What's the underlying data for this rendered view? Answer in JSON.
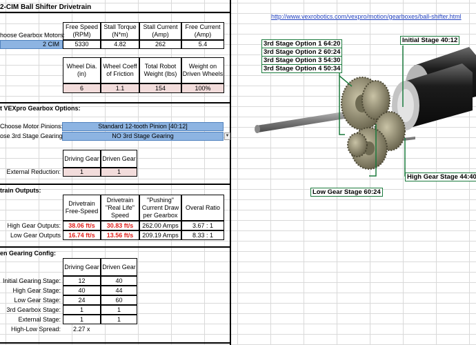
{
  "title": "2-CIM Ball Shifter Drivetrain",
  "link": "http://www.vexrobotics.com/vexpro/motion/gearboxes/ball-shifter.html",
  "motor_table": {
    "row_label": "hoose Gearbox Motors:",
    "motor_value": "2 CIM",
    "headers": [
      "Free Speed (RPM)",
      "Stall Torque (N*m)",
      "Stall Current (Amp)",
      "Free Current (Amp)"
    ],
    "values": [
      "5330",
      "4.82",
      "262",
      "5.4"
    ]
  },
  "wheel_table": {
    "headers": [
      "Wheel Dia. (in)",
      "Wheel Coeff of Friction",
      "Total Robot Weight (lbs)",
      "Weight on Driven Wheels"
    ],
    "values": [
      "6",
      "1.1",
      "154",
      "100%"
    ]
  },
  "options": {
    "section_label": "t VEXpro Gearbox Options:",
    "pinion_label": "Choose Motor Pinions:",
    "pinion_value": "Standard 12-tooth Pinion [40:12]",
    "stage3_label": "ose 3rd Stage Gearing:",
    "stage3_value": "NO 3rd Stage Gearing",
    "ext_headers": [
      "Driving Gear",
      "Driven Gear"
    ],
    "ext_label": "External Reduction:",
    "ext_values": [
      "1",
      "1"
    ]
  },
  "outputs": {
    "section_label": "train Outputs:",
    "headers": [
      "Drivetrain Free-Speed",
      "Drivetrain \"Real Life\" Speed",
      "\"Pushing\" Current Draw per Gearbox",
      "Overal Ratio"
    ],
    "rows": [
      {
        "label": "High Gear Outputs:",
        "free": "38.06 ft/s",
        "real": "30.83 ft/s",
        "current": "262.00 Amps",
        "ratio": "3.67 : 1"
      },
      {
        "label": "Low Gear Outputs",
        "free": "16.74 ft/s",
        "real": "13.56 ft/s",
        "current": "209.19 Amps",
        "ratio": "8.33 : 1"
      }
    ]
  },
  "gearing": {
    "section_label": "en Gearing Config:",
    "headers": [
      "Driving Gear",
      "Driven Gear"
    ],
    "rows": [
      {
        "label": "Initial Gearing Stage:",
        "driving": "12",
        "driven": "40"
      },
      {
        "label": "High Gear Stage:",
        "driving": "40",
        "driven": "44"
      },
      {
        "label": "Low Gear Stage:",
        "driving": "24",
        "driven": "60"
      },
      {
        "label": "3rd Gearbox Stage:",
        "driving": "1",
        "driven": "1"
      },
      {
        "label": "External Stage:",
        "driving": "1",
        "driven": "1"
      }
    ],
    "spread_label": "High-Low Spread:",
    "spread_value": "2.27 x"
  },
  "callouts": {
    "third_stage": [
      "3rd Stage Option 1 64:20",
      "3rd Stage Option 2 60:24",
      "3rd Stage Option 3 54:30",
      "3rd Stage Option 4 50:34"
    ],
    "initial": "Initial Stage 40:12",
    "high": "High Gear Stage 44:40",
    "low": "Low Gear Stage 60:24"
  }
}
